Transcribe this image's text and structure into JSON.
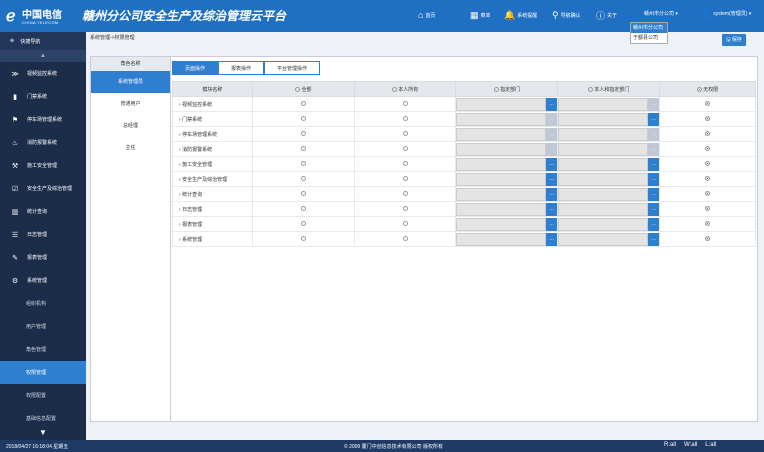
{
  "header": {
    "logo_cn": "中国电信",
    "logo_en": "CHINA TELECOM",
    "app_title": "赣州分公司安全生产及综治管理云平台",
    "nav": [
      {
        "icon": "home-icon",
        "glyph": "⌂",
        "label": "首页"
      },
      {
        "icon": "grid-icon",
        "glyph": "▦",
        "label": "菜单"
      },
      {
        "icon": "bell-icon",
        "glyph": "🔔",
        "label": "系统提醒"
      },
      {
        "icon": "link-icon",
        "glyph": "⚲",
        "label": "导航确认"
      },
      {
        "icon": "info-icon",
        "glyph": "ⓘ",
        "label": "关于"
      }
    ],
    "company_select": "赣州市分公司 ▾",
    "company_options": [
      "赣州市分公司",
      "于都县公司"
    ],
    "user": "system(管理员) ▾"
  },
  "sidebar": {
    "title": "快捷导航",
    "items": [
      {
        "icon": "gauge-icon",
        "glyph": "≫",
        "label": "视频监控系统"
      },
      {
        "icon": "door-icon",
        "glyph": "▮",
        "label": "门禁系统"
      },
      {
        "icon": "parking-icon",
        "glyph": "⚑",
        "label": "停车场管理系统"
      },
      {
        "icon": "fire-icon",
        "glyph": "♨",
        "label": "消防报警系统"
      },
      {
        "icon": "construction-icon",
        "glyph": "⚒",
        "label": "施工安全管理"
      },
      {
        "icon": "check-icon",
        "glyph": "☑",
        "label": "安全生产及综治管理"
      },
      {
        "icon": "chart-icon",
        "glyph": "▥",
        "label": "统计查询"
      },
      {
        "icon": "log-icon",
        "glyph": "☰",
        "label": "日志管理"
      },
      {
        "icon": "edit-icon",
        "glyph": "✎",
        "label": "报表管理"
      },
      {
        "icon": "settings-icon",
        "glyph": "⚙",
        "label": "系统管理"
      }
    ],
    "subitems": [
      "组织机构",
      "用户管理",
      "角色管理",
      "权限管理",
      "权限配置",
      "基础信息配置"
    ],
    "active_sub": 3
  },
  "breadcrumb": "系统管理->权限管理",
  "save_label": "保存",
  "roles": {
    "header": "角色名称",
    "items": [
      "系统管理员",
      "普通用户",
      "总经理",
      "主任"
    ],
    "active": 0
  },
  "tabs": [
    "页面操作",
    "报表操作",
    "平台管理操作"
  ],
  "active_tab": 0,
  "table": {
    "headers": [
      "模块名称",
      "全部",
      "本人所有",
      "指定部门",
      "本人和指定部门",
      "无权限"
    ],
    "rows": [
      {
        "name": "视频监控系统",
        "mode": 5,
        "p1": true,
        "p2": false
      },
      {
        "name": "门禁系统",
        "mode": 5,
        "p1": false,
        "p2": true
      },
      {
        "name": "停车场管理系统",
        "mode": 5,
        "p1": false,
        "p2": false
      },
      {
        "name": "消防报警系统",
        "mode": 5,
        "p1": false,
        "p2": false
      },
      {
        "name": "施工安全管理",
        "mode": 5,
        "p1": true,
        "p2": true
      },
      {
        "name": "安全生产及综治管理",
        "mode": 5,
        "p1": true,
        "p2": true
      },
      {
        "name": "统计查询",
        "mode": 5,
        "p1": true,
        "p2": true
      },
      {
        "name": "日志管理",
        "mode": 5,
        "p1": true,
        "p2": true
      },
      {
        "name": "报表管理",
        "mode": 5,
        "p1": true,
        "p2": true
      },
      {
        "name": "系统管理",
        "mode": 5,
        "p1": true,
        "p2": true
      }
    ]
  },
  "footer": {
    "datetime": "2018/04/27 16:18:04 星期五",
    "copyright": "© 2009 厦门中创信息技术有限公司 版权所有",
    "status": [
      "R:all",
      "W:all",
      "L:all"
    ]
  }
}
